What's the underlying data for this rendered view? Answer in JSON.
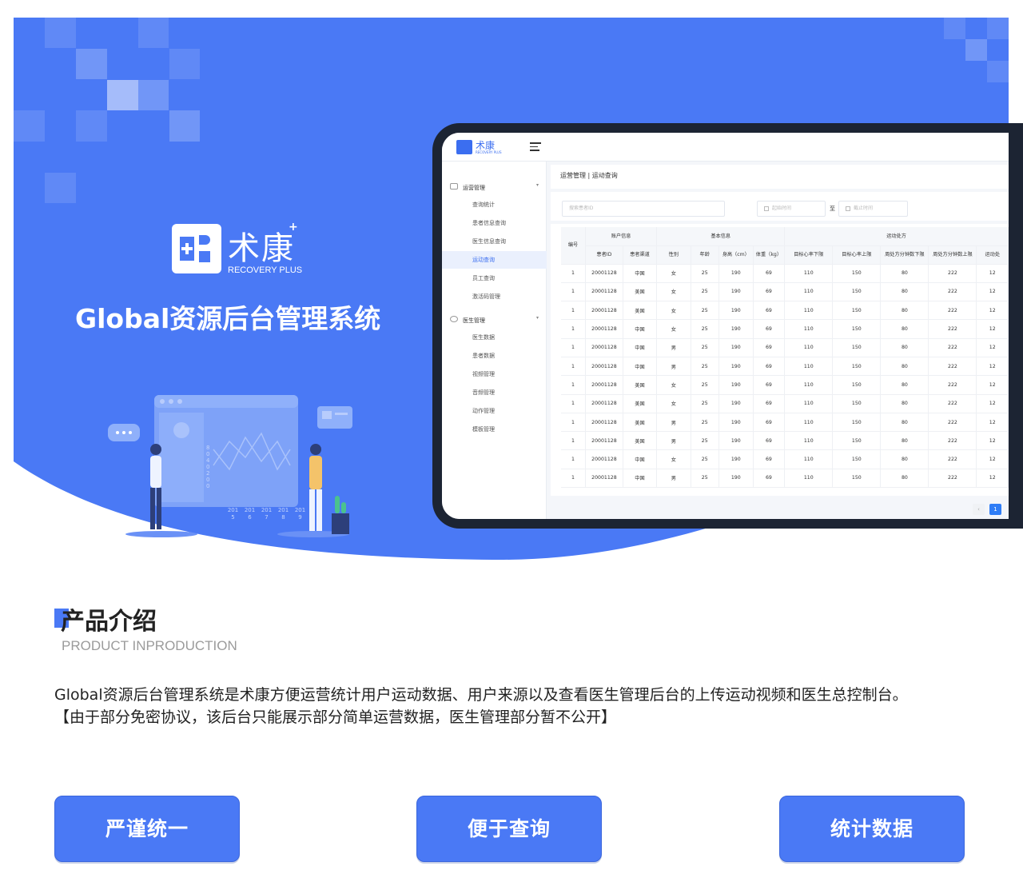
{
  "hero": {
    "brand_name": "术康",
    "brand_plus": "+",
    "brand_sub": "RECOVERY PLUS",
    "title": "Global资源后台管理系统",
    "illus_ticks": [
      "8",
      "0",
      "4",
      "0",
      "2",
      "0",
      "0"
    ],
    "illus_years": [
      "201",
      "201",
      "201",
      "201",
      "201"
    ],
    "illus_year_suffix": [
      "5",
      "6",
      "7",
      "8",
      "9"
    ]
  },
  "app": {
    "logo_name": "术康",
    "logo_sub": "RECOVERY PLUS",
    "breadcrumb": "运营管理 | 运动查询",
    "search_placeholder": "搜索患者ID",
    "start_placeholder": "起始时间",
    "end_placeholder": "截止时间",
    "date_to": "至",
    "sidebar": {
      "group1": "运营管理",
      "group1_items": [
        "查询统计",
        "患者信息查询",
        "医生信息查询",
        "运动查询",
        "员工查询",
        "激活码管理"
      ],
      "group2": "医生管理",
      "group2_items": [
        "医生数据",
        "患者数据",
        "视频管理",
        "音频管理",
        "动作管理",
        "模板管理"
      ],
      "active_item": "运动查询"
    },
    "table": {
      "group_headers": {
        "index": "编号",
        "account": "账户信息",
        "basic": "基本信息",
        "exercise": "运动处方"
      },
      "columns": [
        "患者ID",
        "患者渠道",
        "性别",
        "年龄",
        "身高（cm）",
        "体重（kg）",
        "目标心率下限",
        "目标心率上限",
        "周处方分钟数下限",
        "周处方分钟数上限",
        "运动处"
      ],
      "rows": [
        [
          "1",
          "20001128",
          "中国",
          "女",
          "25",
          "190",
          "69",
          "110",
          "150",
          "80",
          "222",
          "12"
        ],
        [
          "1",
          "20001128",
          "美国",
          "女",
          "25",
          "190",
          "69",
          "110",
          "150",
          "80",
          "222",
          "12"
        ],
        [
          "1",
          "20001128",
          "美国",
          "女",
          "25",
          "190",
          "69",
          "110",
          "150",
          "80",
          "222",
          "12"
        ],
        [
          "1",
          "20001128",
          "中国",
          "女",
          "25",
          "190",
          "69",
          "110",
          "150",
          "80",
          "222",
          "12"
        ],
        [
          "1",
          "20001128",
          "中国",
          "男",
          "25",
          "190",
          "69",
          "110",
          "150",
          "80",
          "222",
          "12"
        ],
        [
          "1",
          "20001128",
          "中国",
          "男",
          "25",
          "190",
          "69",
          "110",
          "150",
          "80",
          "222",
          "12"
        ],
        [
          "1",
          "20001128",
          "美国",
          "女",
          "25",
          "190",
          "69",
          "110",
          "150",
          "80",
          "222",
          "12"
        ],
        [
          "1",
          "20001128",
          "美国",
          "女",
          "25",
          "190",
          "69",
          "110",
          "150",
          "80",
          "222",
          "12"
        ],
        [
          "1",
          "20001128",
          "美国",
          "男",
          "25",
          "190",
          "69",
          "110",
          "150",
          "80",
          "222",
          "12"
        ],
        [
          "1",
          "20001128",
          "美国",
          "男",
          "25",
          "190",
          "69",
          "110",
          "150",
          "80",
          "222",
          "12"
        ],
        [
          "1",
          "20001128",
          "中国",
          "女",
          "25",
          "190",
          "69",
          "110",
          "150",
          "80",
          "222",
          "12"
        ],
        [
          "1",
          "20001128",
          "中国",
          "男",
          "25",
          "190",
          "69",
          "110",
          "150",
          "80",
          "222",
          "12"
        ]
      ]
    },
    "pager": {
      "prev": "‹",
      "current": "1"
    }
  },
  "intro": {
    "title": "产品介绍",
    "subtitle": "PRODUCT INPRODUCTION",
    "line1": "Global资源后台管理系统是术康方便运营统计用户运动数据、用户来源以及查看医生管理后台的上传运动视频和医生总控制台。",
    "line2": "【由于部分免密协议，该后台只能展示部分简单运营数据，医生管理部分暂不公开】"
  },
  "features": [
    "严谨统一",
    "便于查询",
    "统计数据"
  ],
  "colors": {
    "primary": "#4a79f5",
    "device": "#1c2433",
    "pager_active": "#2f7df6"
  }
}
